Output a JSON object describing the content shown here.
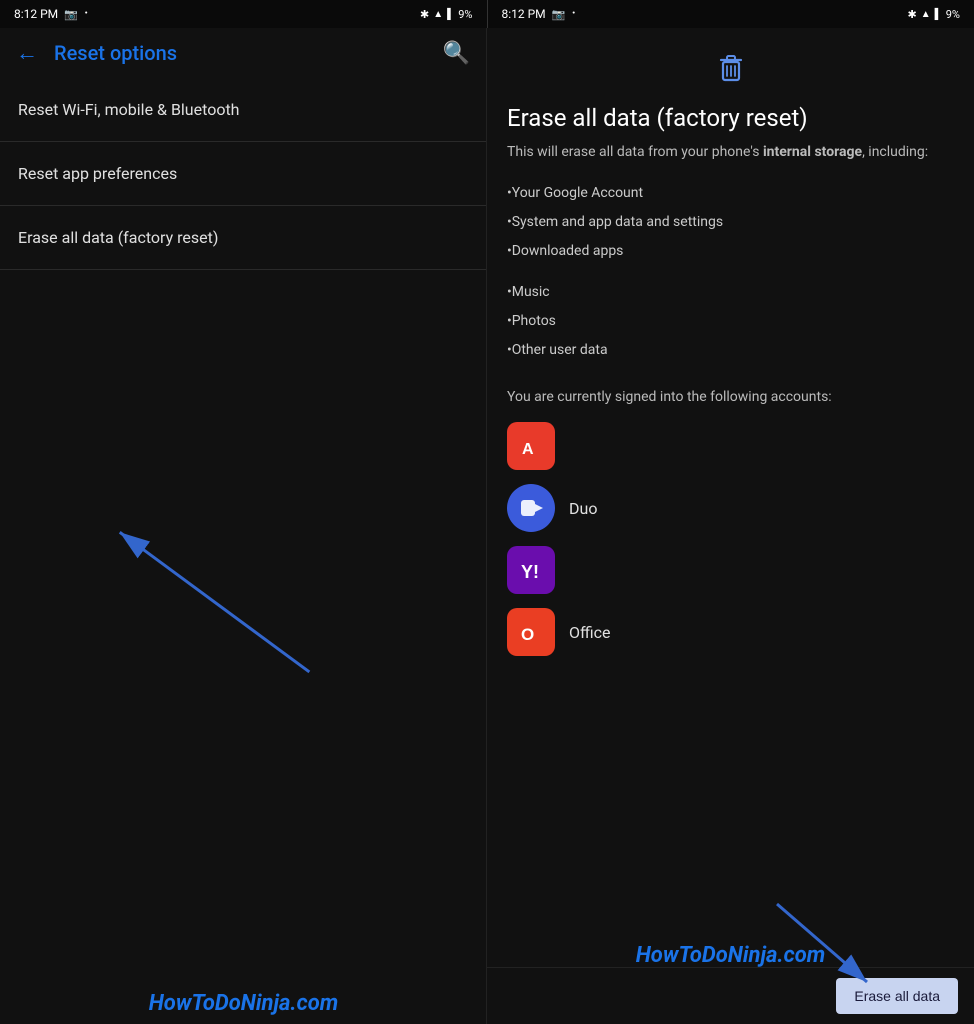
{
  "left_status": {
    "time": "8:12 PM",
    "icons": "🔵 ▲ ▲ 9%"
  },
  "right_status": {
    "time": "8:12 PM",
    "icons": "🔵 ▲ ▲ 9%"
  },
  "left_panel": {
    "back_label": "←",
    "title": "Reset options",
    "search_label": "🔍",
    "menu_items": [
      {
        "id": "wifi-reset",
        "label": "Reset Wi-Fi, mobile & Bluetooth"
      },
      {
        "id": "app-prefs",
        "label": "Reset app preferences"
      },
      {
        "id": "factory-reset",
        "label": "Erase all data (factory reset)"
      }
    ]
  },
  "right_panel": {
    "trash_icon": "🗑",
    "title": "Erase all data (factory reset)",
    "description_prefix": "This will erase all data from your phone's ",
    "description_bold": "internal storage",
    "description_suffix": ", including:",
    "items": [
      {
        "text": "•Your Google Account"
      },
      {
        "text": "•System and app data and settings"
      },
      {
        "text": "•Downloaded apps"
      },
      {
        "spacer": true
      },
      {
        "text": "•Music"
      },
      {
        "text": "•Photos"
      },
      {
        "text": "•Other user data"
      }
    ],
    "accounts_text": "You are currently signed into the following accounts:",
    "accounts": [
      {
        "id": "adobe",
        "type": "adobe",
        "label": ""
      },
      {
        "id": "duo",
        "type": "duo",
        "label": "Duo"
      },
      {
        "id": "yahoo",
        "type": "yahoo",
        "label": ""
      },
      {
        "id": "office",
        "type": "office",
        "label": "Office"
      }
    ],
    "erase_button_label": "Erase all data"
  },
  "watermark": "HowToDoNinja.com"
}
